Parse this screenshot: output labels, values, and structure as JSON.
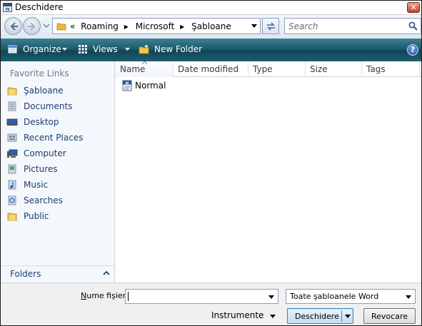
{
  "window": {
    "title": "Deschidere",
    "close_glyph": "✕"
  },
  "address": {
    "overflow": "«",
    "crumbs": [
      "Roaming",
      "Microsoft",
      "Şabloane"
    ]
  },
  "search": {
    "placeholder": "Search"
  },
  "toolbar": {
    "organize": "Organize",
    "views": "Views",
    "new_folder": "New Folder",
    "help": "?"
  },
  "sidebar": {
    "title": "Favorite Links",
    "items": [
      {
        "label": "Şabloane",
        "icon": "folder-icon"
      },
      {
        "label": "Documents",
        "icon": "documents-icon"
      },
      {
        "label": "Desktop",
        "icon": "desktop-icon"
      },
      {
        "label": "Recent Places",
        "icon": "recent-places-icon"
      },
      {
        "label": "Computer",
        "icon": "computer-icon"
      },
      {
        "label": "Pictures",
        "icon": "pictures-icon"
      },
      {
        "label": "Music",
        "icon": "music-icon"
      },
      {
        "label": "Searches",
        "icon": "searches-icon"
      },
      {
        "label": "Public",
        "icon": "folder-icon"
      }
    ],
    "folders_label": "Folders"
  },
  "filelist": {
    "columns": [
      "Name",
      "Date modified",
      "Type",
      "Size",
      "Tags"
    ],
    "files": [
      {
        "name": "Normal",
        "icon": "word-template-icon"
      }
    ]
  },
  "bottom": {
    "filename_label_prefix": "N",
    "filename_label_rest": "ume fişier:",
    "filename_value": "",
    "filetype": "Toate şabloanele Word",
    "tools": "Instrumente",
    "open": "Deschidere",
    "cancel": "Revocare"
  },
  "colors": {
    "toolbar": "#1c5a6e",
    "link": "#1c3e74",
    "folder": "#e8b63a"
  }
}
